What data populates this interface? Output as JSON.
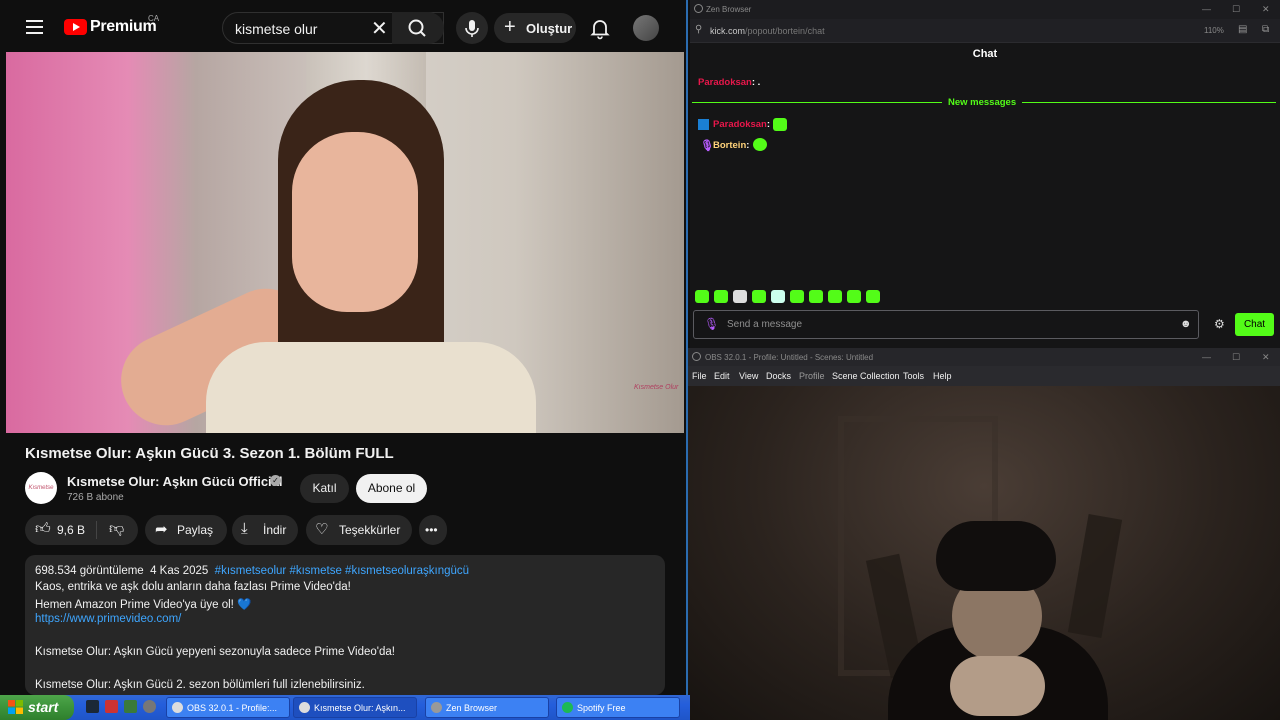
{
  "youtube": {
    "brand": "Premium",
    "region": "CA",
    "search_value": "kismetse olur",
    "create_label": "Oluştur",
    "video_watermark": "Kısmetse Olur",
    "title": "Kısmetse Olur: Aşkın Gücü 3. Sezon 1. Bölüm FULL",
    "channel_avatar_text": "Kısmetse Olur",
    "channel_name": "Kısmetse Olur: Aşkın Gücü Official",
    "subscribers": "726 B abone",
    "join_label": "Katıl",
    "subscribe_label": "Abone ol",
    "likes": "9,6 B",
    "share_label": "Paylaş",
    "download_label": "İndir",
    "thanks_label": "Teşekkürler",
    "more_label": "•••",
    "description": {
      "views": "698.534 görüntüleme",
      "date": "4 Kas 2025",
      "hashtags": "#kısmetseolur #kısmetse #kısmetseoluraşkıngücü",
      "line1": "Kaos, entrika ve aşk dolu anların daha fazlası Prime Video'da!",
      "line2": "Hemen Amazon Prime Video'ya üye ol! 💙",
      "link": "https://www.primevideo.com/",
      "line3": "Kısmetse Olur: Aşkın Gücü yepyeni sezonuyla sadece Prime Video'da!",
      "line4": "Kısmetse Olur: Aşkın Gücü 2. sezon bölümleri full izlenebilirsiniz."
    }
  },
  "zen": {
    "window_title": "Zen Browser",
    "url_host": "kick.com",
    "url_path": "/popout/bortein/chat",
    "zoom": "110%",
    "chat_title": "Chat",
    "first_message_user": "Paradoksan",
    "first_message_text": ": .",
    "new_messages_label": "New messages",
    "messages": [
      {
        "user": "Paradoksan",
        "sep": ":",
        "color": "#e8174b"
      },
      {
        "user": "Bortein",
        "sep": ":",
        "color": "#ffd27a"
      }
    ],
    "input_placeholder": "Send a message",
    "send_label": "Chat",
    "accent": "#53fc18"
  },
  "obs": {
    "window_title": "OBS 32.0.1 - Profile: Untitled - Scenes: Untitled",
    "menu": [
      "File",
      "Edit",
      "View",
      "Docks",
      "Profile",
      "Scene Collection",
      "Tools",
      "Help"
    ]
  },
  "taskbar": {
    "start_label": "start",
    "tasks": [
      {
        "label": "OBS 32.0.1 - Profile:...",
        "active": false
      },
      {
        "label": "Kısmetse Olur: Aşkın...",
        "active": true
      },
      {
        "label": "Zen Browser",
        "active": false
      },
      {
        "label": "Spotify Free",
        "active": false
      }
    ]
  }
}
